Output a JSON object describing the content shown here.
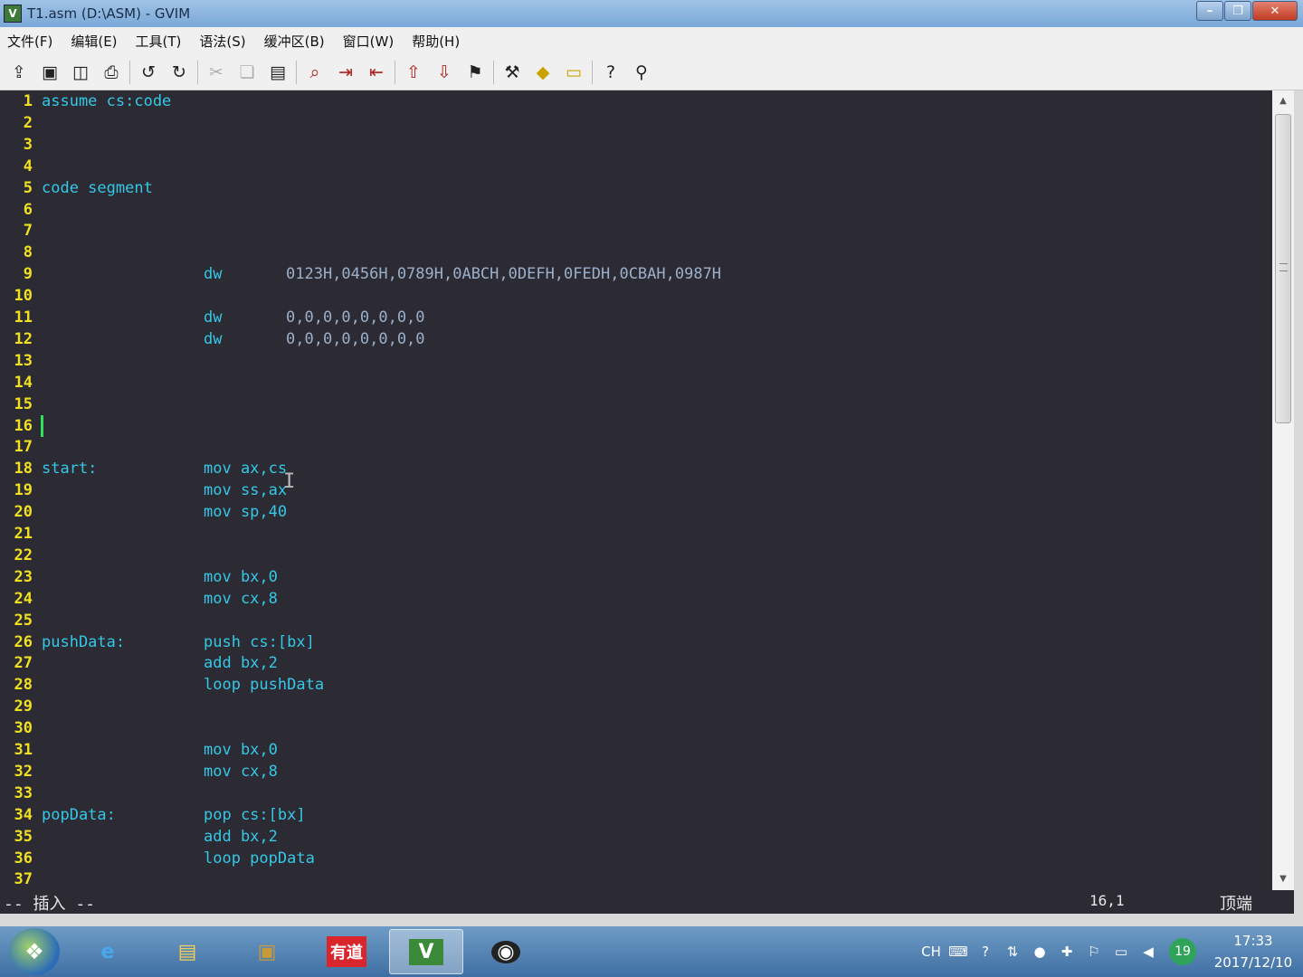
{
  "window": {
    "title": "T1.asm (D:\\ASM) - GVIM"
  },
  "menu": [
    "文件(F)",
    "编辑(E)",
    "工具(T)",
    "语法(S)",
    "缓冲区(B)",
    "窗口(W)",
    "帮助(H)"
  ],
  "toolbar": [
    "open-icon",
    "save-icon",
    "save-all-icon",
    "print-icon",
    "undo-icon",
    "redo-icon",
    "cut-icon",
    "copy-icon",
    "paste-icon",
    "find-replace-icon",
    "find-next-icon",
    "find-prev-icon",
    "load-session-icon",
    "save-session-icon",
    "run-script-icon",
    "make-icon",
    "build-tags-icon",
    "jump-tag-icon",
    "help-icon",
    "find-help-icon"
  ],
  "editor": {
    "lines": [
      {
        "n": "1",
        "a": "assume cs:code",
        "b": "",
        "c": ""
      },
      {
        "n": "2",
        "a": "",
        "b": "",
        "c": ""
      },
      {
        "n": "3",
        "a": "",
        "b": "",
        "c": ""
      },
      {
        "n": "4",
        "a": "",
        "b": "",
        "c": ""
      },
      {
        "n": "5",
        "a": "code segment",
        "b": "",
        "c": ""
      },
      {
        "n": "6",
        "a": "",
        "b": "",
        "c": ""
      },
      {
        "n": "7",
        "a": "",
        "b": "",
        "c": ""
      },
      {
        "n": "8",
        "a": "",
        "b": "",
        "c": ""
      },
      {
        "n": "9",
        "a": "",
        "b": "dw",
        "c": "0123H,0456H,0789H,0ABCH,0DEFH,0FEDH,0CBAH,0987H"
      },
      {
        "n": "10",
        "a": "",
        "b": "",
        "c": ""
      },
      {
        "n": "11",
        "a": "",
        "b": "dw",
        "c": "0,0,0,0,0,0,0,0"
      },
      {
        "n": "12",
        "a": "",
        "b": "dw",
        "c": "0,0,0,0,0,0,0,0"
      },
      {
        "n": "13",
        "a": "",
        "b": "",
        "c": ""
      },
      {
        "n": "14",
        "a": "",
        "b": "",
        "c": ""
      },
      {
        "n": "15",
        "a": "",
        "b": "",
        "c": ""
      },
      {
        "n": "16",
        "a": "",
        "b": "",
        "c": ""
      },
      {
        "n": "17",
        "a": "",
        "b": "",
        "c": ""
      },
      {
        "n": "18",
        "a": "start:",
        "b": "mov ax,cs",
        "c": ""
      },
      {
        "n": "19",
        "a": "",
        "b": "mov ss,ax",
        "c": ""
      },
      {
        "n": "20",
        "a": "",
        "b": "mov sp,40",
        "c": ""
      },
      {
        "n": "21",
        "a": "",
        "b": "",
        "c": ""
      },
      {
        "n": "22",
        "a": "",
        "b": "",
        "c": ""
      },
      {
        "n": "23",
        "a": "",
        "b": "mov bx,0",
        "c": ""
      },
      {
        "n": "24",
        "a": "",
        "b": "mov cx,8",
        "c": ""
      },
      {
        "n": "25",
        "a": "",
        "b": "",
        "c": ""
      },
      {
        "n": "26",
        "a": "pushData:",
        "b": "push cs:[bx]",
        "c": ""
      },
      {
        "n": "27",
        "a": "",
        "b": "add bx,2",
        "c": ""
      },
      {
        "n": "28",
        "a": "",
        "b": "loop pushData",
        "c": ""
      },
      {
        "n": "29",
        "a": "",
        "b": "",
        "c": ""
      },
      {
        "n": "30",
        "a": "",
        "b": "",
        "c": ""
      },
      {
        "n": "31",
        "a": "",
        "b": "mov bx,0",
        "c": ""
      },
      {
        "n": "32",
        "a": "",
        "b": "mov cx,8",
        "c": ""
      },
      {
        "n": "33",
        "a": "",
        "b": "",
        "c": ""
      },
      {
        "n": "34",
        "a": "popData:",
        "b": "pop cs:[bx]",
        "c": ""
      },
      {
        "n": "35",
        "a": "",
        "b": "add bx,2",
        "c": ""
      },
      {
        "n": "36",
        "a": "",
        "b": "loop popData",
        "c": ""
      },
      {
        "n": "37",
        "a": "",
        "b": "",
        "c": ""
      }
    ],
    "cursor_line": 16
  },
  "status": {
    "mode": "-- 插入 --",
    "position": "16,1",
    "scroll": "顶端"
  },
  "taskbar": {
    "apps": [
      {
        "name": "ie-icon",
        "glyph": "e"
      },
      {
        "name": "explorer-icon",
        "glyph": "▤"
      },
      {
        "name": "archive-icon",
        "glyph": "▣"
      },
      {
        "name": "youdao-icon",
        "glyph": "有道"
      },
      {
        "name": "gvim-icon",
        "glyph": "V"
      },
      {
        "name": "obs-icon",
        "glyph": "◉"
      }
    ],
    "tray_lang": "CH",
    "badge": "19",
    "time": "17:33",
    "date": "2017/12/10"
  }
}
